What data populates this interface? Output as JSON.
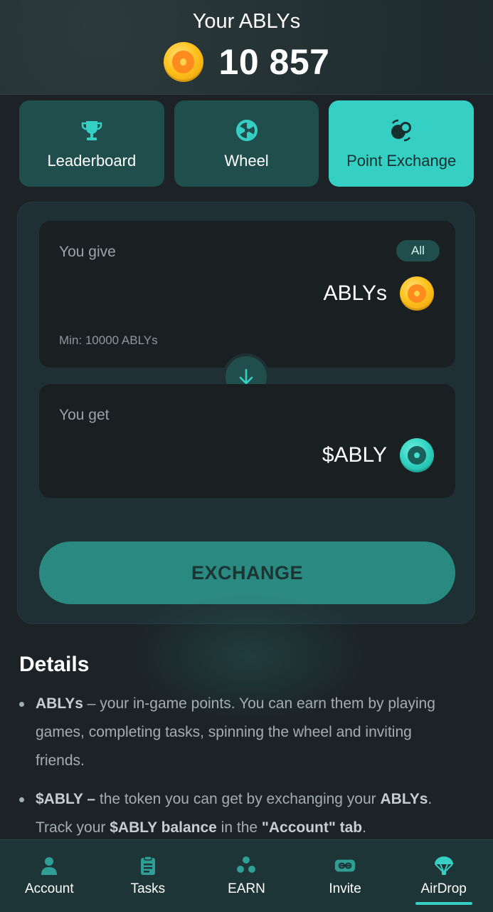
{
  "header": {
    "title": "Your ABLYs",
    "balance": "10 857",
    "coin_icon": "ably-coin-icon"
  },
  "tabs": [
    {
      "label": "Leaderboard",
      "icon": "trophy-icon",
      "active": false
    },
    {
      "label": "Wheel",
      "icon": "wheel-icon",
      "active": false
    },
    {
      "label": "Point Exchange",
      "icon": "exchange-icon",
      "active": true
    }
  ],
  "exchange": {
    "give_label": "You give",
    "all_label": "All",
    "give_token": "ABLYs",
    "min_text": "Min: 10000 ABLYs",
    "get_label": "You get",
    "get_token": "$ABLY",
    "button_label": "EXCHANGE"
  },
  "details": {
    "title": "Details",
    "item1": {
      "term": "ABLYs",
      "text": " – your in-game points. You can earn them by playing games, completing tasks, spinning the wheel and inviting friends."
    },
    "item2": {
      "term": "$ABLY –",
      "text1": " the token you can get by exchanging your ",
      "term2": "ABLYs",
      "text2": ". Track your ",
      "term3": "$ABLY balance",
      "text3": " in the ",
      "term4": "\"Account\" tab",
      "text4": "."
    }
  },
  "nav": [
    {
      "label": "Account",
      "icon": "user-icon",
      "active": false
    },
    {
      "label": "Tasks",
      "icon": "clipboard-icon",
      "active": false
    },
    {
      "label": "EARN",
      "icon": "earn-icon",
      "active": false
    },
    {
      "label": "Invite",
      "icon": "invite-icon",
      "active": false
    },
    {
      "label": "AirDrop",
      "icon": "parachute-icon",
      "active": true
    }
  ],
  "colors": {
    "accent": "#35d0c3",
    "background": "#1c2226",
    "tab_inactive": "#1f4e4d",
    "button": "#2a8a82",
    "coin_gold": "#ffc21d"
  }
}
